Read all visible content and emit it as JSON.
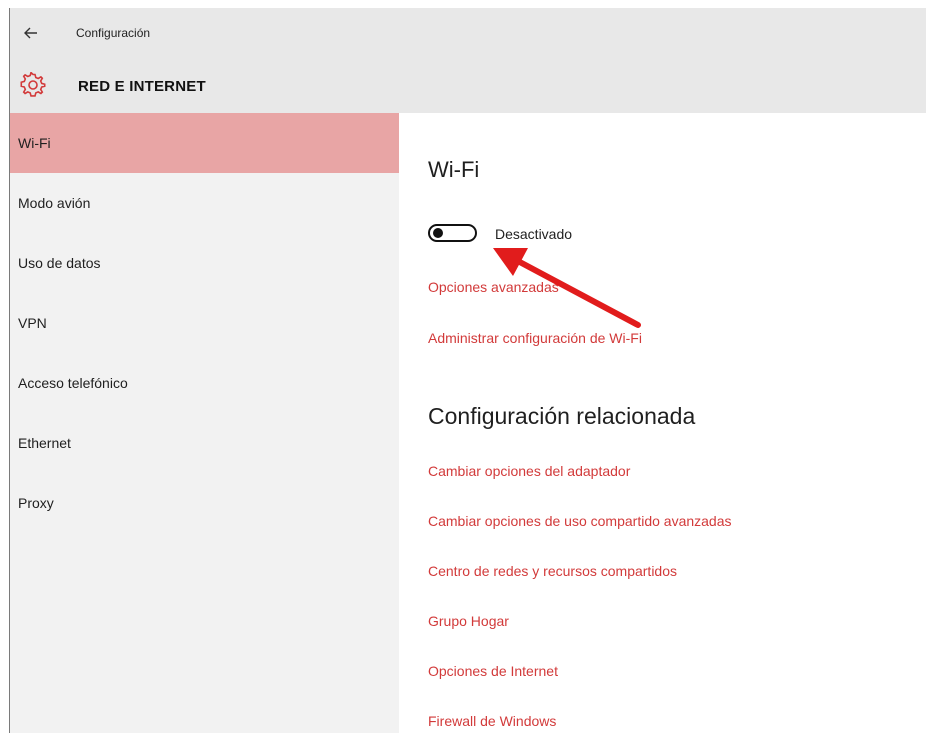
{
  "window": {
    "back_icon": "back-arrow-icon",
    "title": "Configuración"
  },
  "header": {
    "icon": "gear-icon",
    "icon_color": "#d23a3a",
    "title": "RED E INTERNET"
  },
  "sidebar": {
    "active_color": "#e8a5a5",
    "items": [
      {
        "label": "Wi-Fi",
        "active": true
      },
      {
        "label": "Modo avión"
      },
      {
        "label": "Uso de datos"
      },
      {
        "label": "VPN"
      },
      {
        "label": "Acceso telefónico"
      },
      {
        "label": "Ethernet"
      },
      {
        "label": "Proxy"
      }
    ]
  },
  "main": {
    "wifi_heading": "Wi-Fi",
    "wifi_toggle": {
      "state": "off",
      "label": "Desactivado"
    },
    "wifi_links": [
      "Opciones avanzadas",
      "Administrar configuración de Wi-Fi"
    ],
    "related_heading": "Configuración relacionada",
    "related_links": [
      "Cambiar opciones del adaptador",
      "Cambiar opciones de uso compartido avanzadas",
      "Centro de redes y recursos compartidos",
      "Grupo Hogar",
      "Opciones de Internet",
      "Firewall de Windows"
    ],
    "link_color": "#d23a3a"
  },
  "annotation": {
    "arrow_color": "#e11c1c"
  }
}
